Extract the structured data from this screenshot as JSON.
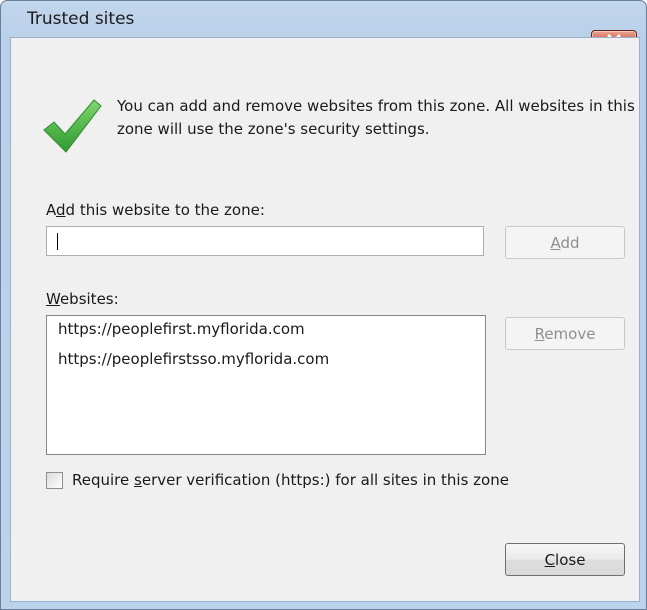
{
  "window": {
    "title": "Trusted sites"
  },
  "info": {
    "message": "You can add and remove websites from this zone. All websites in this zone will use the zone's security settings."
  },
  "add_section": {
    "label_pre": "A",
    "label_accel": "d",
    "label_post": "d this website to the zone:",
    "input_value": "",
    "add_button_accel": "A",
    "add_button_rest": "dd"
  },
  "websites_section": {
    "label_accel": "W",
    "label_rest": "ebsites:",
    "items": [
      "https://peoplefirst.myflorida.com",
      "https://peoplefirstsso.myflorida.com"
    ],
    "remove_button_accel": "R",
    "remove_button_rest": "emove"
  },
  "verification": {
    "checked": false,
    "label_pre": "Require ",
    "label_accel": "s",
    "label_post": "erver verification (https:) for all sites in this zone"
  },
  "footer": {
    "close_accel": "C",
    "close_rest": "lose"
  },
  "icons": {
    "check": "checkmark-icon",
    "close": "close-icon"
  },
  "colors": {
    "close_button": "#c13e22",
    "checkmark": "#3aa63a",
    "frame": "#b9d0ea"
  }
}
